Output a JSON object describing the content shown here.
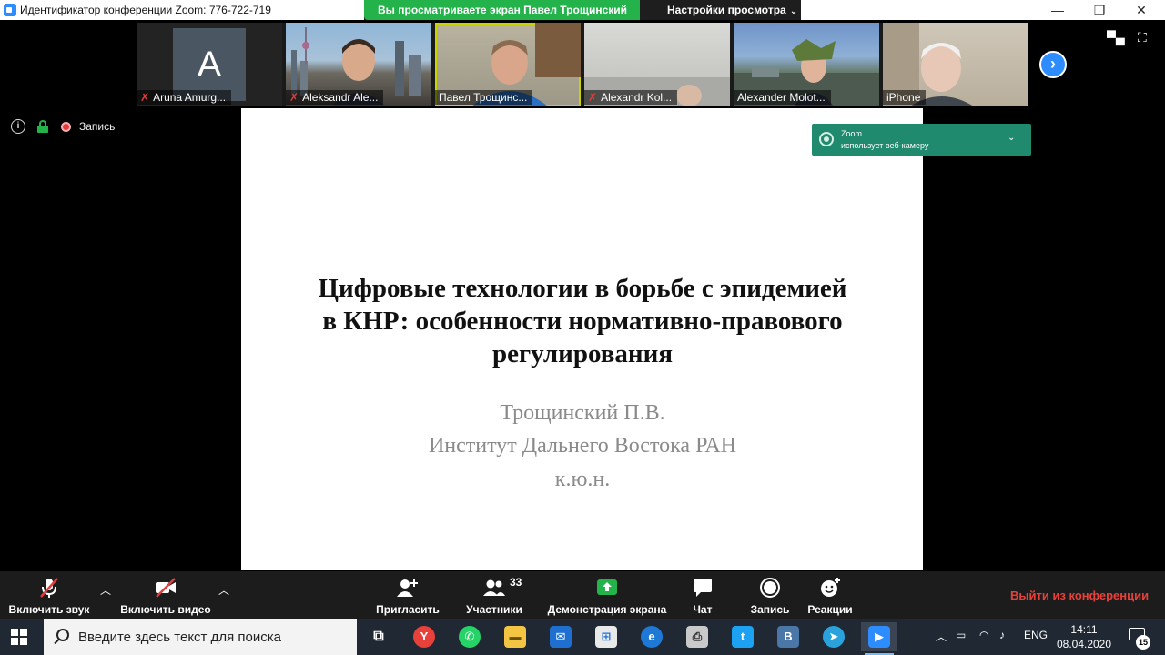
{
  "window": {
    "title": "Идентификатор конференции Zoom: 776-722-719",
    "minimize": "—",
    "maximize": "❐",
    "close": "✕"
  },
  "share_banner": {
    "viewing_text": "Вы просматриваете экран Павел Трощинский",
    "view_settings_label": "Настройки просмотра"
  },
  "participants": [
    {
      "name": "Aruna Amurg...",
      "muted": true,
      "avatar_letter": "A"
    },
    {
      "name": "Aleksandr Ale...",
      "muted": true
    },
    {
      "name": "Павел Трощинс...",
      "muted": false,
      "active": true
    },
    {
      "name": "Alexandr Kol...",
      "muted": true
    },
    {
      "name": "Alexander Molot...",
      "muted": false
    },
    {
      "name": "iPhone",
      "muted": false
    }
  ],
  "meeting_status": {
    "recording_label": "Запись"
  },
  "slide": {
    "title_lines": [
      "Цифровые технологии в борьбе с эпидемией",
      "в КНР: особенности нормативно-правового",
      "регулирования"
    ],
    "author": "Трощинский П.В.",
    "institute": "Институт Дальнего Востока РАН",
    "degree": "к.ю.н."
  },
  "notification": {
    "line1": "Zoom",
    "line2": "использует веб-камеру"
  },
  "controls": {
    "unmute_label": "Включить звук",
    "start_video_label": "Включить видео",
    "invite_label": "Пригласить",
    "participants_label": "Участники",
    "participants_count": "33",
    "share_screen_label": "Демонстрация экрана",
    "chat_label": "Чат",
    "record_label": "Запись",
    "reactions_label": "Реакции",
    "leave_label": "Выйти из конференции"
  },
  "taskbar": {
    "search_placeholder": "Введите здесь текст для поиска",
    "language": "ENG",
    "time": "14:11",
    "date": "08.04.2020",
    "notification_count": "15"
  },
  "colors": {
    "zoom_blue": "#2d8cff",
    "green_banner": "#24b24a",
    "leave_red": "#e8413b",
    "notification_green": "#1f8a6e"
  }
}
